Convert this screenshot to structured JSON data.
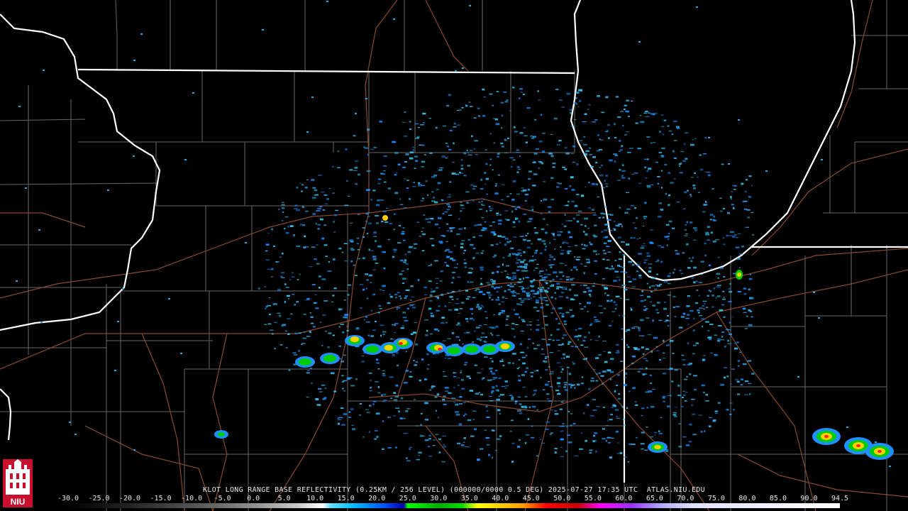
{
  "product_caption": "KLOT LONG RANGE BASE REFLECTIVITY (0.25KM / 256 LEVEL) (000000/0000 0.5 DEG) 2025-07-27 17:35 UTC  ATLAS.NIU.EDU",
  "radar_site": "KLOT",
  "timestamp": "2025-07-27 17:35 UTC",
  "source": "ATLAS.NIU.EDU",
  "scale_values": [
    "-30.0",
    "-25.0",
    "-20.0",
    "-15.0",
    "-10.0",
    "-5.0",
    "0.0",
    "5.0",
    "10.0",
    "15.0",
    "20.0",
    "25.0",
    "30.0",
    "35.0",
    "40.0",
    "45.0",
    "50.0",
    "55.0",
    "60.0",
    "65.0",
    "70.0",
    "75.0",
    "80.0",
    "85.0",
    "90.0",
    "94.5"
  ],
  "logo_text": "NIU",
  "colors": {
    "background": "#000000",
    "state_border": "#ffffff",
    "county_border": "#888888",
    "road": "#8b4a2b",
    "light_echo": "#2aa7e0",
    "moderate_echo": "#00dd00",
    "heavy_echo": "#ffd000",
    "intense_echo": "#ff2020"
  },
  "icons": {
    "logo": "niu-tower-logo",
    "radar_site": "radar-site-dot"
  }
}
